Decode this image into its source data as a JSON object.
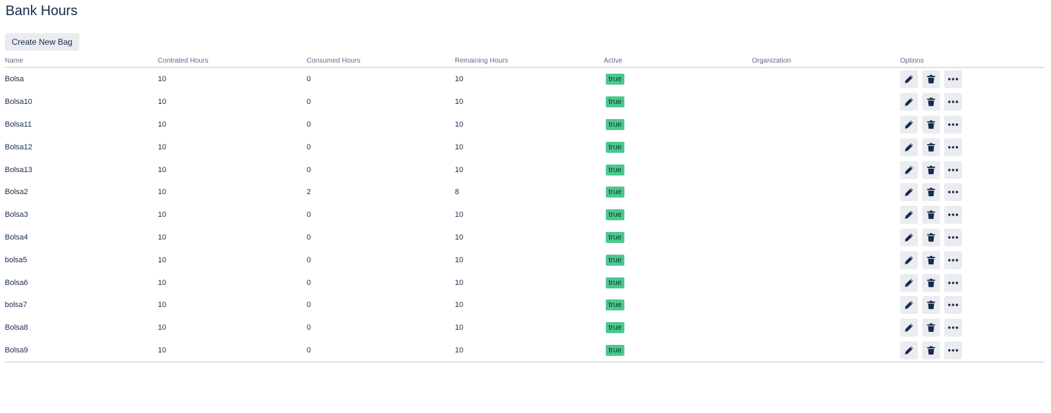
{
  "page": {
    "title": "Bank Hours",
    "create_button_label": "Create New Bag"
  },
  "table": {
    "columns": [
      "Name",
      "Contrated Hours",
      "Consumed Hours",
      "Remaining Hours",
      "Active",
      "Organization",
      "Options"
    ],
    "rows": [
      {
        "name": "Bolsa",
        "contracted": "10",
        "consumed": "0",
        "remaining": "10",
        "active": "true",
        "organization": ""
      },
      {
        "name": "Bolsa10",
        "contracted": "10",
        "consumed": "0",
        "remaining": "10",
        "active": "true",
        "organization": ""
      },
      {
        "name": "Bolsa11",
        "contracted": "10",
        "consumed": "0",
        "remaining": "10",
        "active": "true",
        "organization": ""
      },
      {
        "name": "Bolsa12",
        "contracted": "10",
        "consumed": "0",
        "remaining": "10",
        "active": "true",
        "organization": ""
      },
      {
        "name": "Bolsa13",
        "contracted": "10",
        "consumed": "0",
        "remaining": "10",
        "active": "true",
        "organization": ""
      },
      {
        "name": "Bolsa2",
        "contracted": "10",
        "consumed": "2",
        "remaining": "8",
        "active": "true",
        "organization": ""
      },
      {
        "name": "Bolsa3",
        "contracted": "10",
        "consumed": "0",
        "remaining": "10",
        "active": "true",
        "organization": ""
      },
      {
        "name": "Bolsa4",
        "contracted": "10",
        "consumed": "0",
        "remaining": "10",
        "active": "true",
        "organization": ""
      },
      {
        "name": "bolsa5",
        "contracted": "10",
        "consumed": "0",
        "remaining": "10",
        "active": "true",
        "organization": ""
      },
      {
        "name": "Bolsa6",
        "contracted": "10",
        "consumed": "0",
        "remaining": "10",
        "active": "true",
        "organization": ""
      },
      {
        "name": "bolsa7",
        "contracted": "10",
        "consumed": "0",
        "remaining": "10",
        "active": "true",
        "organization": ""
      },
      {
        "name": "Bolsa8",
        "contracted": "10",
        "consumed": "0",
        "remaining": "10",
        "active": "true",
        "organization": ""
      },
      {
        "name": "Bolsa9",
        "contracted": "10",
        "consumed": "0",
        "remaining": "10",
        "active": "true",
        "organization": ""
      }
    ],
    "option_icons": [
      "pencil-icon",
      "trash-icon",
      "more-icon"
    ]
  },
  "colors": {
    "title": "#172b4d",
    "header_text": "#5e6c84",
    "button_bg": "#ebecf0",
    "active_badge": "#4cc791",
    "divider": "#dfe1e6"
  }
}
